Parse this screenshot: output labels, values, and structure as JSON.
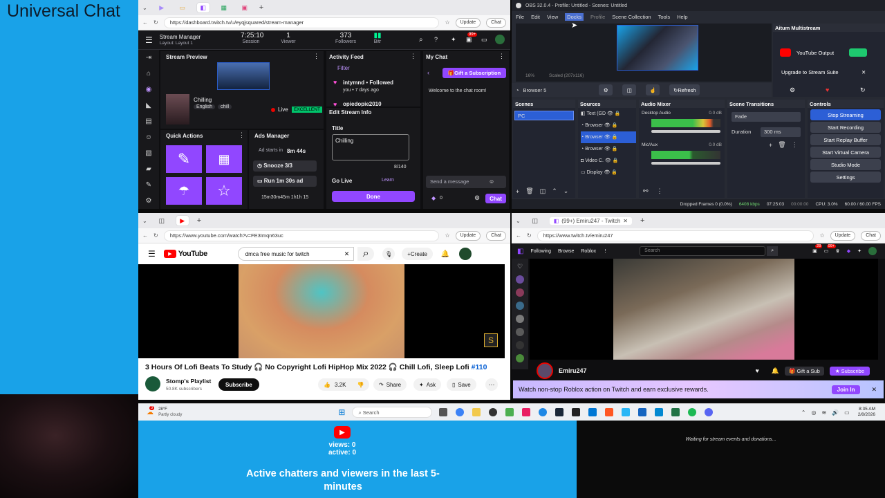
{
  "overlay": {
    "title": "Universal Chat",
    "views_label": "views: 0",
    "active_label": "active: 0",
    "chatters_text": "Active chatters and viewers in the last 5-minutes",
    "waiting_text": "Waiting for stream events and donations..."
  },
  "twitch_dashboard": {
    "url": "https://dashboard.twitch.tv/u/eyqjsquared/stream-manager",
    "update_label": "Update",
    "chat_label": "Chat",
    "page_title": "Stream Manager",
    "layout_label": "Layout: Layout 1",
    "stats": [
      {
        "value": "7:25:10",
        "label": "Session"
      },
      {
        "value": "1",
        "label": "Viewer"
      },
      {
        "value": "373",
        "label": "Followers"
      },
      {
        "value": "",
        "label": "Bitr"
      }
    ],
    "notif_badge": "99+",
    "stream_preview_label": "Stream Preview",
    "stream_title": "Chilling",
    "tags": [
      "English",
      "chill"
    ],
    "live_label": "Live",
    "health_label": "EXCELLENT",
    "quick_actions_label": "Quick Actions",
    "ads_manager_label": "Ads Manager",
    "ad_starts_label": "Ad starts in",
    "ad_starts_time": "8m 44s",
    "snooze_label": "Snooze 3/3",
    "run_ad_label": "Run 1m 30s ad",
    "ad_timing": "15m30m45m  1h1h 15",
    "activity_feed_label": "Activity Feed",
    "filter_label": "Filter",
    "activity_items": [
      {
        "user": "intymnd",
        "action": "Followed",
        "sub": "you • 7 days ago"
      },
      {
        "user": "opiedopie2010",
        "action": "",
        "sub": ""
      }
    ],
    "edit_stream_label": "Edit Stream Info",
    "title_label": "Title",
    "title_value": "Chilling",
    "char_count": "8/140",
    "go_live_label": "Go Live",
    "learn_label": "Learn",
    "done_label": "Done",
    "my_chat_label": "My Chat",
    "gift_sub_label": "Gift a Subscription",
    "welcome_text": "Welcome to the chat room!",
    "send_placeholder": "Send a message",
    "points_value": "0",
    "chat_button": "Chat"
  },
  "obs": {
    "title": "OBS 32.0.4 - Profile: Untitled - Scenes: Untitled",
    "menu": [
      "File",
      "Edit",
      "View",
      "Docks",
      "Profile",
      "Scene Collection",
      "Tools",
      "Help"
    ],
    "zoom_label": "16%",
    "scaled_label": "Scaled (207x116)",
    "source_name": "Browser 5",
    "refresh_label": "Refresh",
    "multistream_title": "Aitum Multistream",
    "youtube_output_label": "YouTube Output",
    "upgrade_label": "Upgrade to Stream Suite",
    "scenes_label": "Scenes",
    "scenes": [
      "PC"
    ],
    "sources_label": "Sources",
    "sources": [
      "Text (GD",
      "Browser",
      "Browser",
      "Browser",
      "Video C.",
      "Display"
    ],
    "audio_mixer_label": "Audio Mixer",
    "desktop_audio_label": "Desktop Audio",
    "desktop_audio_db": "0.0 dB",
    "mic_label": "Mic/Aux",
    "mic_db": "0.0 dB",
    "transitions_label": "Scene Transitions",
    "transition_value": "Fade",
    "duration_label": "Duration",
    "duration_value": "300 ms",
    "controls_label": "Controls",
    "controls": [
      "Stop Streaming",
      "Start Recording",
      "Start Replay Buffer",
      "Start Virtual Camera",
      "Studio Mode",
      "Settings"
    ],
    "status": {
      "dropped": "Dropped Frames 0 (0.0%)",
      "bitrate": "6408 kbps",
      "stream_time": "07:25:03",
      "rec_time": "00:00:00",
      "cpu": "CPU: 3.0%",
      "fps": "60.00 / 60.00 FPS"
    }
  },
  "youtube": {
    "url": "https://www.youtube.com/watch?v=FE3Imqn63uc",
    "update_label": "Update",
    "chat_label": "Chat",
    "brand": "YouTube",
    "search_value": "dmca free music for twitch",
    "create_label": "Create",
    "video_title": "3 Hours Of Lofi Beats To Study 🎧 No Copyright Lofi HipHop Mix 2022 🎧 Chill Lofi, Sleep Lofi",
    "video_tag": "#110",
    "channel_name": "Stomp's Playlist",
    "subscribers": "50.8K subscribers",
    "subscribe_label": "Subscribe",
    "likes": "3.2K",
    "share_label": "Share",
    "ask_label": "Ask",
    "save_label": "Save"
  },
  "twitch_viewer": {
    "tab_title": "(99+) Emiru247 - Twitch",
    "url": "https://www.twitch.tv/emiru247",
    "update_label": "Update",
    "chat_label": "Chat",
    "nav": [
      "Following",
      "Browse",
      "Roblox"
    ],
    "search_placeholder": "Search",
    "notif_badge": "28",
    "inbox_badge": "99+",
    "streamer_name": "Emiru247",
    "gift_sub_label": "Gift a Sub",
    "subscribe_label": "Subscribe",
    "promo_text": "Watch non-stop Roblox action on Twitch and earn exclusive rewards.",
    "join_label": "Join In"
  },
  "taskbar": {
    "weather_temp": "28°F",
    "weather_desc": "Partly cloudy",
    "weather_badge": "3",
    "search_label": "Search",
    "time": "8:35 AM",
    "date": "2/8/2026"
  },
  "colors": {
    "twitch_purple": "#9147ff",
    "overlay_blue": "#19a2e8",
    "youtube_red": "#ff0000",
    "obs_bg": "#272a33"
  }
}
